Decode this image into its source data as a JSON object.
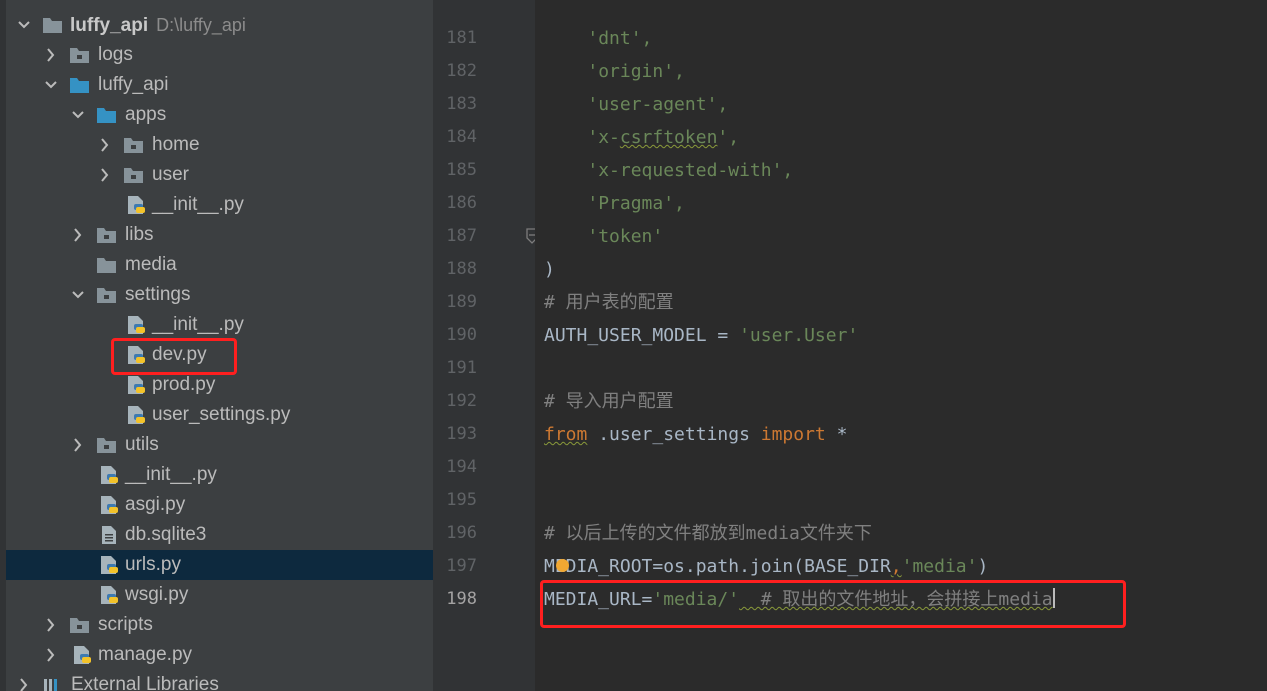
{
  "project_tree": {
    "root": {
      "name": "luffy_api",
      "path": "D:\\luffy_api"
    },
    "items": [
      {
        "label": "logs"
      },
      {
        "label": "luffy_api"
      },
      {
        "label": "apps"
      },
      {
        "label": "home"
      },
      {
        "label": "user"
      },
      {
        "label": "__init__.py"
      },
      {
        "label": "libs"
      },
      {
        "label": "media"
      },
      {
        "label": "settings"
      },
      {
        "label": "__init__.py"
      },
      {
        "label": "dev.py"
      },
      {
        "label": "prod.py"
      },
      {
        "label": "user_settings.py"
      },
      {
        "label": "utils"
      },
      {
        "label": "__init__.py"
      },
      {
        "label": "asgi.py"
      },
      {
        "label": "db.sqlite3"
      },
      {
        "label": "urls.py"
      },
      {
        "label": "wsgi.py"
      },
      {
        "label": "scripts"
      },
      {
        "label": "manage.py"
      },
      {
        "label": "External Libraries"
      }
    ]
  },
  "editor": {
    "line_numbers": [
      "181",
      "182",
      "183",
      "184",
      "185",
      "186",
      "187",
      "188",
      "189",
      "190",
      "191",
      "192",
      "193",
      "194",
      "195",
      "196",
      "197",
      "198"
    ],
    "lines": {
      "l181": "'dnt',",
      "l182": "'origin',",
      "l183": "'user-agent',",
      "l184a": "'x-",
      "l184b": "csrftoken",
      "l184c": "',",
      "l185": "'x-requested-with',",
      "l186": "'Pragma',",
      "l187": "'token'",
      "l188": ")",
      "l189": "# 用户表的配置",
      "l190a": "AUTH_USER_MODEL = ",
      "l190b": "'user.User'",
      "l192": "# 导入用户配置",
      "l193a": "from",
      "l193b": " .user_settings ",
      "l193c": "import",
      "l193d": " *",
      "l196": "# 以后上传的文件都放到media文件夹下",
      "l197a": "MEDIA_ROOT=os.path.join(BASE_DIR",
      "l197b": ",",
      "l197c": "'media'",
      "l197d": ")",
      "l198a": "MEDIA_URL=",
      "l198b": "'media/'",
      "l198c": "  # 取出的文件地址，会拼接上media"
    }
  },
  "colors": {
    "highlight": "#ff1f1f",
    "selection": "#0d293e",
    "string": "#6a8759",
    "keyword": "#cc7832",
    "comment": "#808080"
  }
}
